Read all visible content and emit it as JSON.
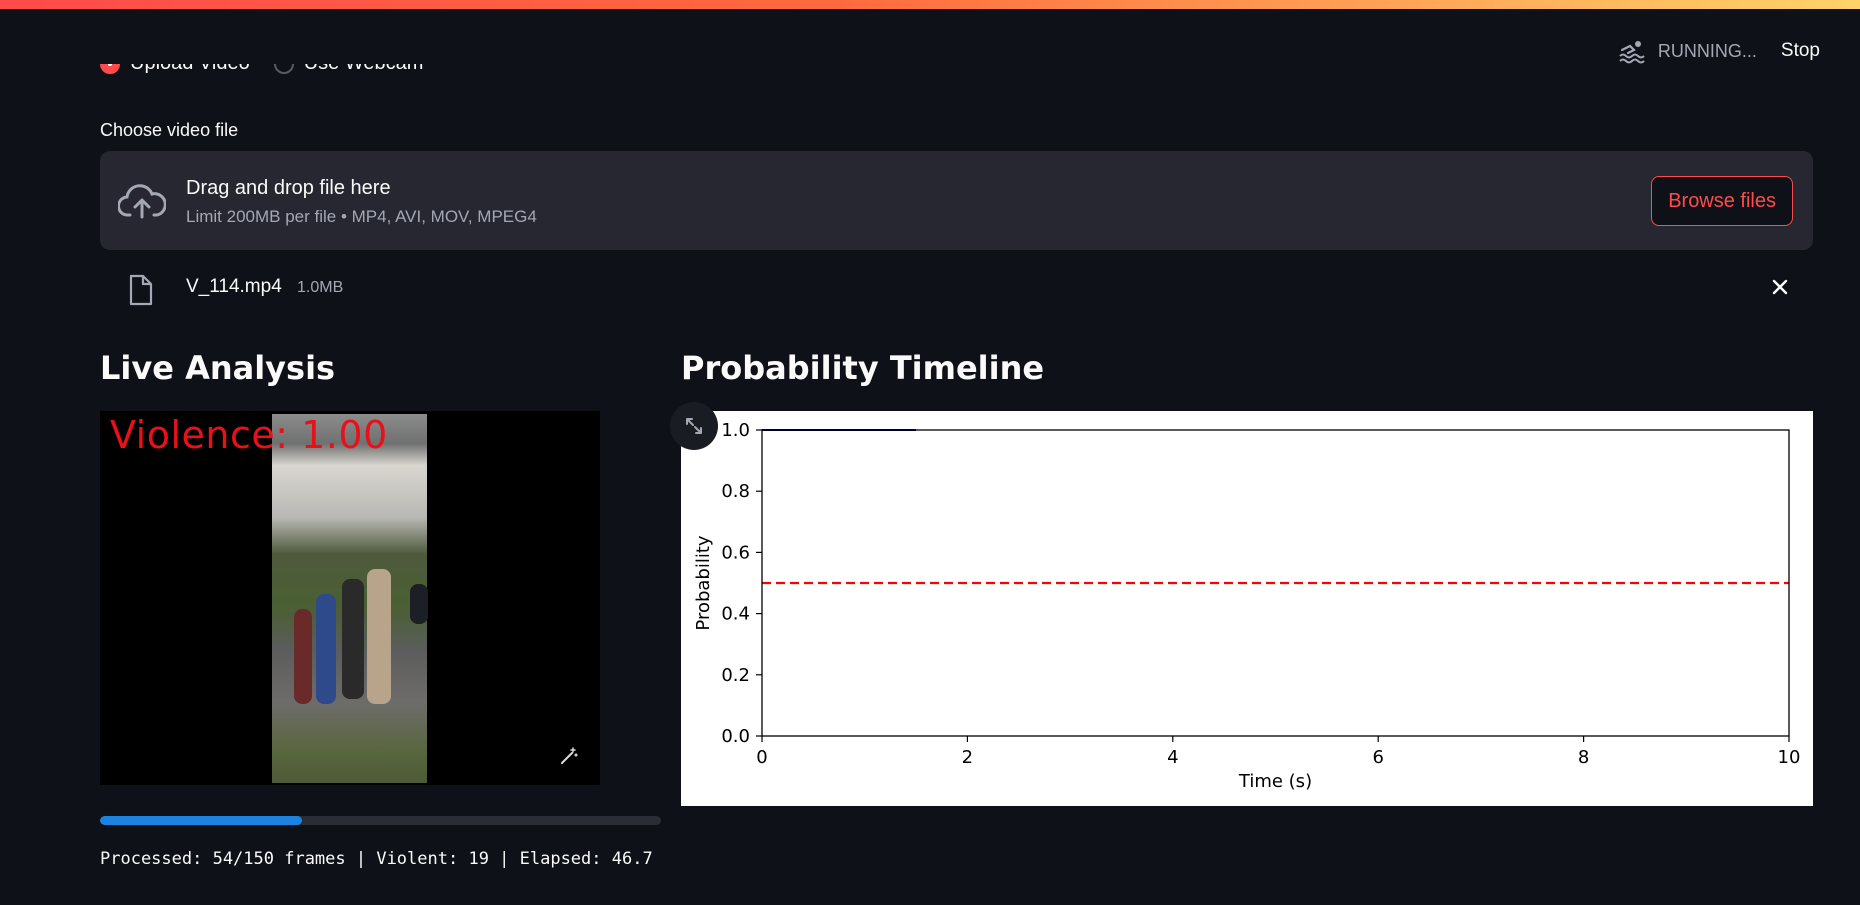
{
  "status": {
    "running_label": "RUNNING...",
    "stop_label": "Stop",
    "icon": "swimmer-icon"
  },
  "input_source": {
    "options": [
      "Upload Video",
      "Use Webcam"
    ],
    "selected": "Upload Video"
  },
  "uploader": {
    "label": "Choose video file",
    "drop_text": "Drag and drop file here",
    "limit_text": "Limit 200MB per file • MP4, AVI, MOV, MPEG4",
    "browse_label": "Browse files",
    "icon": "cloud-upload-icon"
  },
  "file": {
    "name": "V_114.mp4",
    "size": "1.0MB",
    "icon": "file-icon"
  },
  "live": {
    "title": "Live Analysis",
    "overlay_text": "Violence: 1.00",
    "progress_fraction": 0.36,
    "processed_text": "Processed: 54/150 frames | Violent: 19 | Elapsed: 46.7"
  },
  "timeline": {
    "title": "Probability Timeline"
  },
  "colors": {
    "accent": "#ff4b4b",
    "progress": "#1c83e1",
    "background": "#0e1117",
    "overlay": "#e8111a"
  },
  "chart_data": {
    "type": "line",
    "xlabel": "Time (s)",
    "ylabel": "Probability",
    "xlim": [
      0,
      10
    ],
    "ylim": [
      0,
      1.0
    ],
    "xticks": [
      "0",
      "2",
      "4",
      "6",
      "8",
      "10"
    ],
    "yticks": [
      "0.0",
      "0.2",
      "0.4",
      "0.6",
      "0.8",
      "1.0"
    ],
    "series": [
      {
        "color": "#00008b",
        "x": [
          0,
          1.5
        ],
        "values": [
          1.0,
          1.0
        ]
      }
    ],
    "threshold": {
      "value": 0.5,
      "style": "dashed",
      "color": "#ff0000"
    },
    "grid": false
  }
}
